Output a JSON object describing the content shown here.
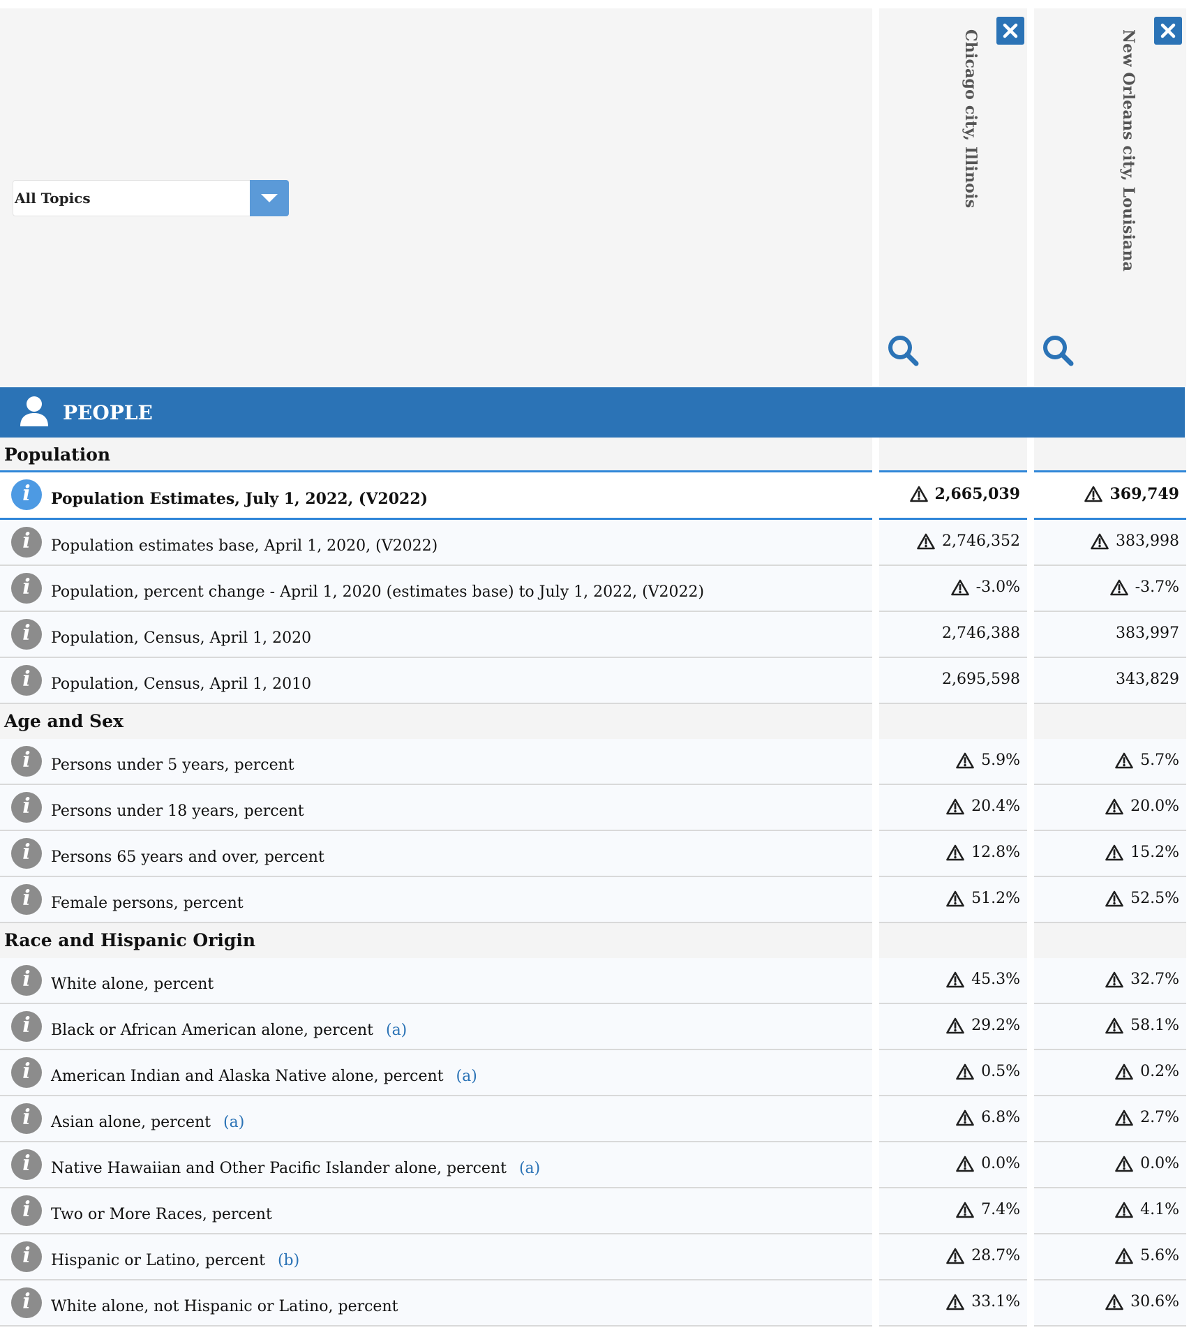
{
  "topic_select": {
    "selected": "All Topics"
  },
  "columns": [
    {
      "name": "Chicago city, Illinois"
    },
    {
      "name": "New Orleans city, Louisiana"
    }
  ],
  "people_header": "PEOPLE",
  "sections": [
    {
      "title": "Population"
    },
    {
      "title": "Age and Sex"
    },
    {
      "title": "Race and Hispanic Origin"
    }
  ],
  "rows": [
    {
      "label": "Population Estimates, July 1, 2022, (V2022)",
      "note": "",
      "v1": "2,665,039",
      "v2": "369,749",
      "warn": true
    },
    {
      "label": "Population estimates base, April 1, 2020, (V2022)",
      "note": "",
      "v1": "2,746,352",
      "v2": "383,998",
      "warn": true
    },
    {
      "label": "Population, percent change - April 1, 2020 (estimates base) to July 1, 2022, (V2022)",
      "note": "",
      "v1": "-3.0%",
      "v2": "-3.7%",
      "warn": true
    },
    {
      "label": "Population, Census, April 1, 2020",
      "note": "",
      "v1": "2,746,388",
      "v2": "383,997",
      "warn": false
    },
    {
      "label": "Population, Census, April 1, 2010",
      "note": "",
      "v1": "2,695,598",
      "v2": "343,829",
      "warn": false
    },
    {
      "label": "Persons under 5 years, percent",
      "note": "",
      "v1": "5.9%",
      "v2": "5.7%",
      "warn": true
    },
    {
      "label": "Persons under 18 years, percent",
      "note": "",
      "v1": "20.4%",
      "v2": "20.0%",
      "warn": true
    },
    {
      "label": "Persons 65 years and over, percent",
      "note": "",
      "v1": "12.8%",
      "v2": "15.2%",
      "warn": true
    },
    {
      "label": "Female persons, percent",
      "note": "",
      "v1": "51.2%",
      "v2": "52.5%",
      "warn": true
    },
    {
      "label": "White alone, percent",
      "note": "",
      "v1": "45.3%",
      "v2": "32.7%",
      "warn": true
    },
    {
      "label": "Black or African American alone, percent",
      "note": "(a)",
      "v1": "29.2%",
      "v2": "58.1%",
      "warn": true
    },
    {
      "label": "American Indian and Alaska Native alone, percent",
      "note": "(a)",
      "v1": "0.5%",
      "v2": "0.2%",
      "warn": true
    },
    {
      "label": "Asian alone, percent",
      "note": "(a)",
      "v1": "6.8%",
      "v2": "2.7%",
      "warn": true
    },
    {
      "label": "Native Hawaiian and Other Pacific Islander alone, percent",
      "note": "(a)",
      "v1": "0.0%",
      "v2": "0.0%",
      "warn": true
    },
    {
      "label": "Two or More Races, percent",
      "note": "",
      "v1": "7.4%",
      "v2": "4.1%",
      "warn": true
    },
    {
      "label": "Hispanic or Latino, percent",
      "note": "(b)",
      "v1": "28.7%",
      "v2": "5.6%",
      "warn": true
    },
    {
      "label": "White alone, not Hispanic or Latino, percent",
      "note": "",
      "v1": "33.1%",
      "v2": "30.6%",
      "warn": true
    }
  ],
  "icons": {
    "close": "close-icon",
    "search": "search-icon",
    "info": "info-icon",
    "warning": "warning-icon",
    "person": "person-icon",
    "dropdown": "chevron-down-icon"
  },
  "colors": {
    "accent": "#2b73b6",
    "highlight_border": "#2f86d8",
    "info_gray": "#8c8c8c"
  }
}
